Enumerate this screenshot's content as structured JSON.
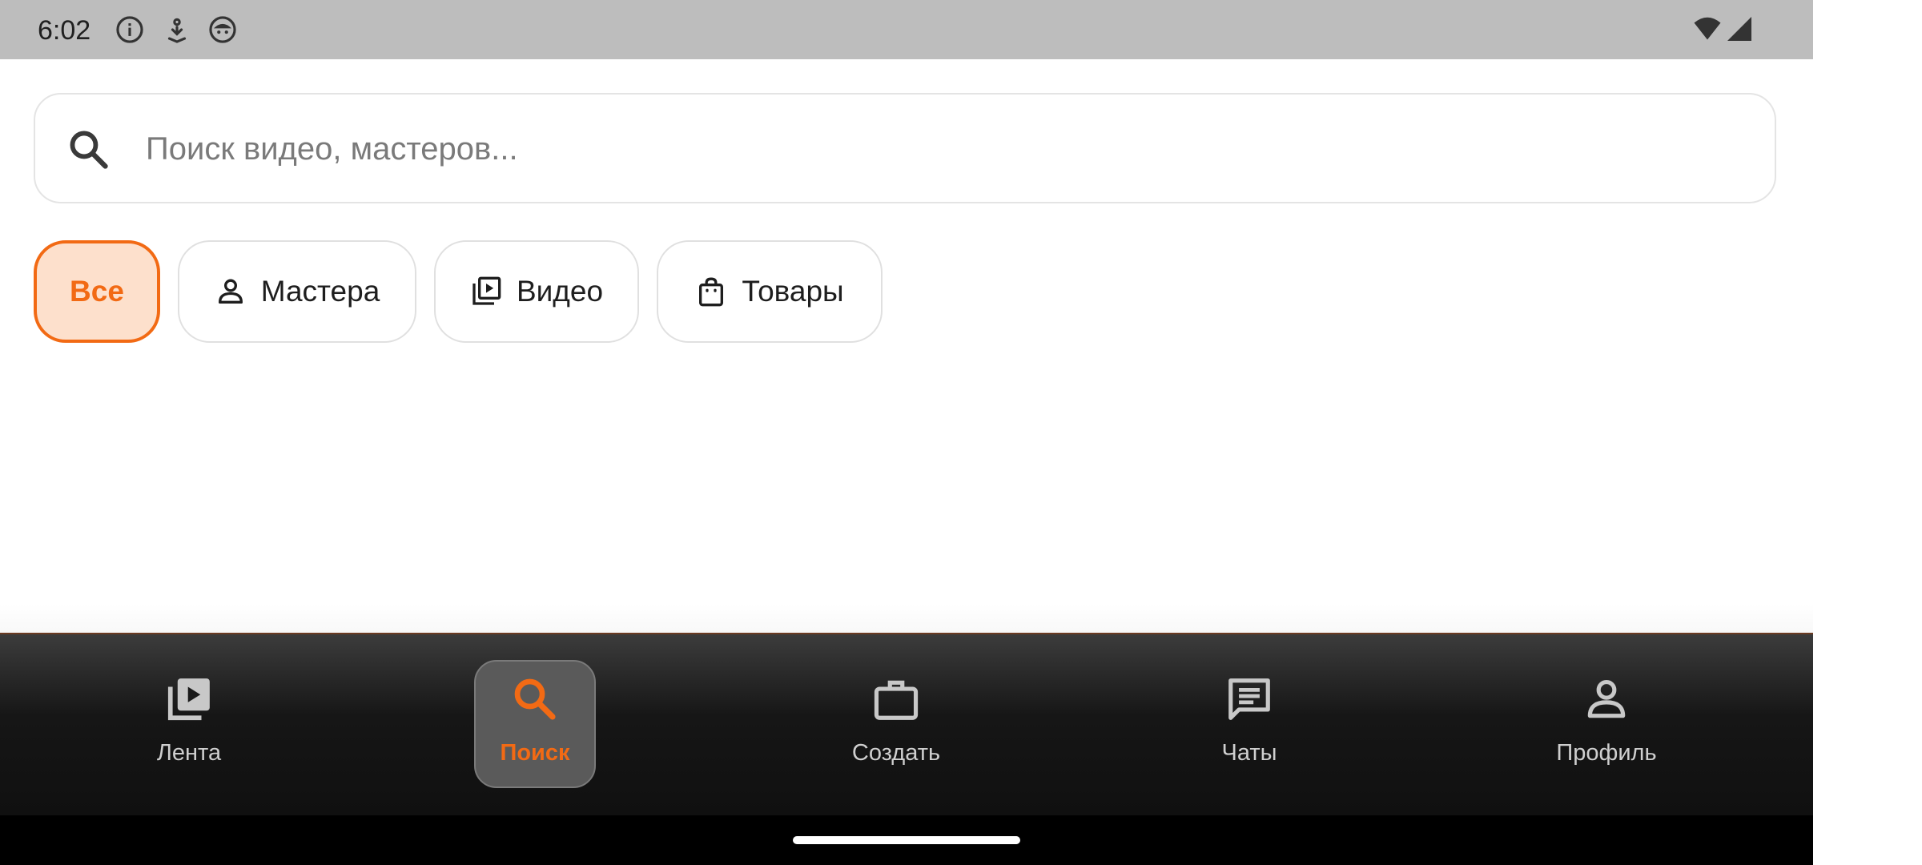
{
  "status_bar": {
    "time": "6:02",
    "left_icons": [
      "info-icon",
      "download-icon",
      "android-icon"
    ],
    "right_icons": [
      "wifi-icon",
      "signal-icon"
    ]
  },
  "search": {
    "placeholder": "Поиск видео, мастеров...",
    "value": ""
  },
  "filters": {
    "selected": "Все",
    "chips": [
      {
        "label": "Все",
        "icon": null
      },
      {
        "label": "Мастера",
        "icon": "person-icon"
      },
      {
        "label": "Видео",
        "icon": "video-library-icon"
      },
      {
        "label": "Товары",
        "icon": "shopping-bag-icon"
      }
    ]
  },
  "bottom_nav": {
    "active": "Поиск",
    "items": [
      {
        "label": "Лента",
        "icon": "video-library-icon"
      },
      {
        "label": "Поиск",
        "icon": "search-icon"
      },
      {
        "label": "Создать",
        "icon": "briefcase-icon"
      },
      {
        "label": "Чаты",
        "icon": "chat-icon"
      },
      {
        "label": "Профиль",
        "icon": "person-icon"
      }
    ]
  },
  "colors": {
    "accent": "#f26a14",
    "chip_selected_bg": "#fde0cc",
    "status_bar_bg": "#bdbdbd",
    "nav_bg": "#141414"
  }
}
